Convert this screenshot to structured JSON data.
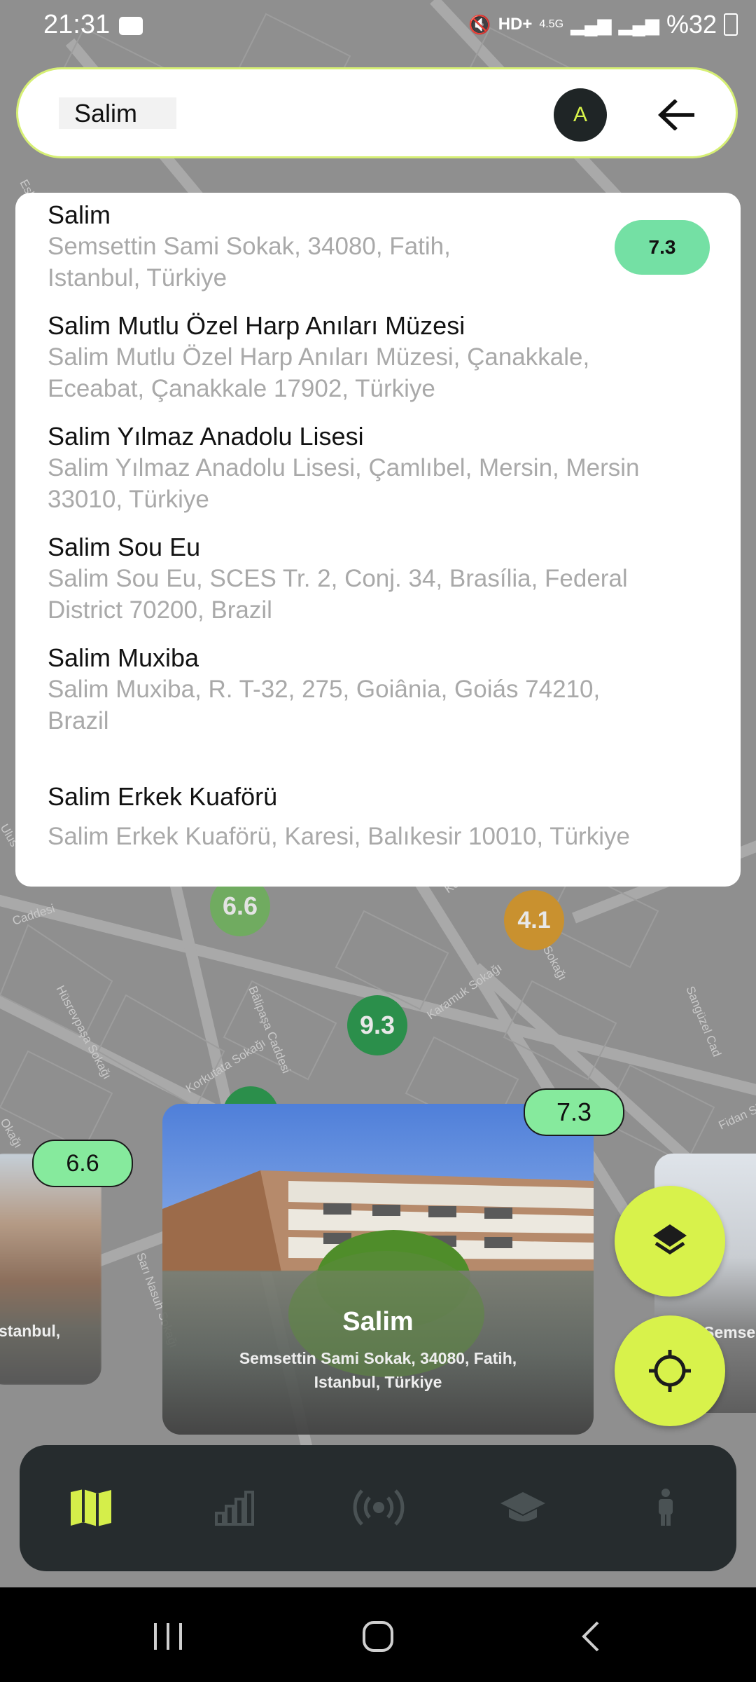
{
  "status_bar": {
    "time": "21:31",
    "battery": "%32",
    "network": "4.5G"
  },
  "search": {
    "value": "Salim",
    "avatar_letter": "A"
  },
  "suggestions": [
    {
      "title": "Salim",
      "line1": "Semsettin Sami Sokak, 34080, Fatih,",
      "line2": "Istanbul, Türkiye",
      "score": "7.3"
    },
    {
      "title": "Salim Mutlu Özel Harp Anıları Müzesi",
      "line1": "Salim Mutlu Özel Harp Anıları Müzesi, Çanakkale,",
      "line2": "Eceabat, Çanakkale 17902, Türkiye"
    },
    {
      "title": "Salim Yılmaz Anadolu Lisesi",
      "line1": "Salim Yılmaz Anadolu Lisesi, Çamlıbel, Mersin, Mersin",
      "line2": "33010, Türkiye"
    },
    {
      "title": "Salim Sou Eu",
      "line1": "Salim Sou Eu, SCES Tr. 2, Conj. 34, Brasília, Federal",
      "line2": "District 70200, Brazil"
    },
    {
      "title": "Salim Muxiba",
      "line1": "Salim Muxiba, R. T-32, 275, Goiânia, Goiás 74210,",
      "line2": "Brazil"
    },
    {
      "title": "Salim Erkek Kuaförü",
      "line1": "Salim Erkek Kuaförü, Karesi, Balıkesir 10010, Türkiye"
    }
  ],
  "map": {
    "street_labels": [
      "Caddesi",
      "Hüsrevpaşa Sokağı",
      "Bâlipaşa Caddesi",
      "Korkutata Sokağı",
      "Karamuk Sokağı",
      "Sami Sokağı",
      "Sangüzel Cad",
      "Sarı Nasuh Sokağı",
      "Fidan Sk",
      "Eski",
      "Ulus",
      "Okağı",
      "Kor"
    ],
    "markers": [
      {
        "value": "6.6",
        "color": "#7fbf6a"
      },
      {
        "value": "4.1",
        "color": "#d49a3a"
      },
      {
        "value": "9.3",
        "color": "#2f9a52"
      }
    ]
  },
  "cards": {
    "main": {
      "title": "Salim",
      "line1": "Semsettin Sami Sokak, 34080, Fatih,",
      "line2": "Istanbul, Türkiye",
      "score": "7.3"
    },
    "left": {
      "snippet": "stanbul,",
      "score": "6.6"
    },
    "right": {
      "snippet": "Semse"
    }
  },
  "fabs": {
    "layers": "layers-icon",
    "locate": "crosshair-icon"
  },
  "bottom_nav": [
    "map-icon",
    "stats-icon",
    "broadcast-icon",
    "education-icon",
    "person-icon"
  ],
  "colors": {
    "accent": "#d8f24b",
    "nav_bg": "#262c2e",
    "score_green": "#74e0a4"
  }
}
